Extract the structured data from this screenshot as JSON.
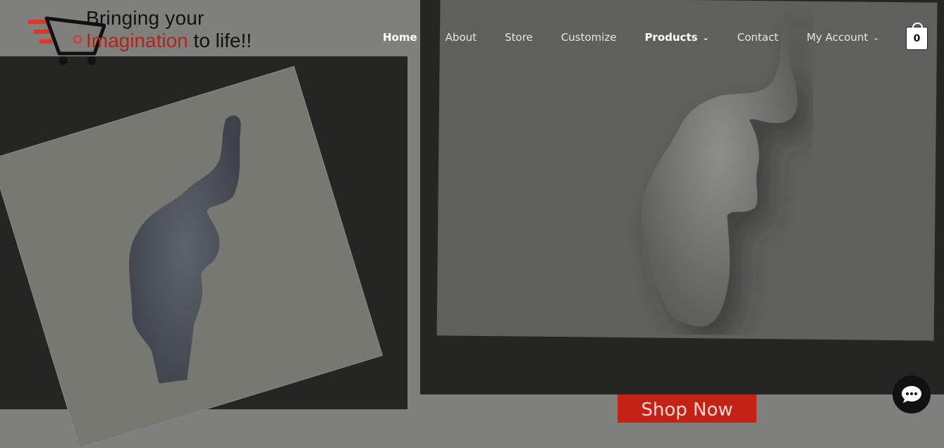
{
  "brand": {
    "tagline_line1": "Bringing your",
    "tagline_line2_accent": "Imagination",
    "tagline_line2_rest": " to life!!",
    "accent_color": "#b3241d",
    "logo_icon": "shopping-cart-icon"
  },
  "nav": {
    "items": [
      {
        "label": "Home",
        "active": true,
        "dropdown": false
      },
      {
        "label": "About",
        "active": false,
        "dropdown": false
      },
      {
        "label": "Store",
        "active": false,
        "dropdown": false
      },
      {
        "label": "Customize",
        "active": false,
        "dropdown": false
      },
      {
        "label": "Products",
        "active": false,
        "dropdown": true
      },
      {
        "label": "Contact",
        "active": false,
        "dropdown": false
      },
      {
        "label": "My Account",
        "active": false,
        "dropdown": true
      }
    ]
  },
  "cart": {
    "count": "0",
    "icon": "shopping-bag-icon"
  },
  "hero": {
    "cta_label": "Shop Now",
    "cta_color": "#c52217"
  },
  "chat": {
    "icon": "chat-bubble-icon"
  }
}
